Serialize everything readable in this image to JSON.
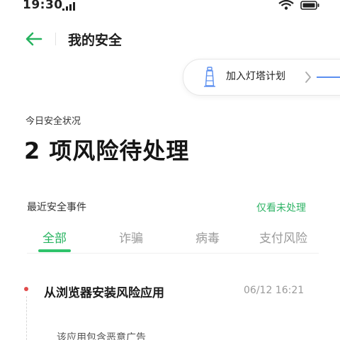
{
  "status_bar": {
    "time": "19:30",
    "icons": [
      "signal-icon",
      "wifi-icon",
      "battery-icon"
    ]
  },
  "header": {
    "title": "我的安全",
    "back_icon": "back-arrow-icon"
  },
  "lighthouse": {
    "label": "加入灯塔计划",
    "icon": "lighthouse-icon"
  },
  "today": {
    "label": "今日安全状况",
    "risk_summary": "2 项风险待处理"
  },
  "recent": {
    "label": "最近安全事件",
    "filter_link": "仅看未处理"
  },
  "tabs": [
    {
      "label": "全部",
      "active": true
    },
    {
      "label": "诈骗",
      "active": false
    },
    {
      "label": "病毒",
      "active": false
    },
    {
      "label": "支付风险",
      "active": false
    }
  ],
  "events": [
    {
      "title": "从浏览器安装风险应用",
      "time": "06/12  16:21",
      "description": "该应用包含恶意广告"
    }
  ],
  "colors": {
    "accent_green": "#2fc36b",
    "alert_red": "#e14b4b",
    "link_blue": "#5b8ff0"
  }
}
